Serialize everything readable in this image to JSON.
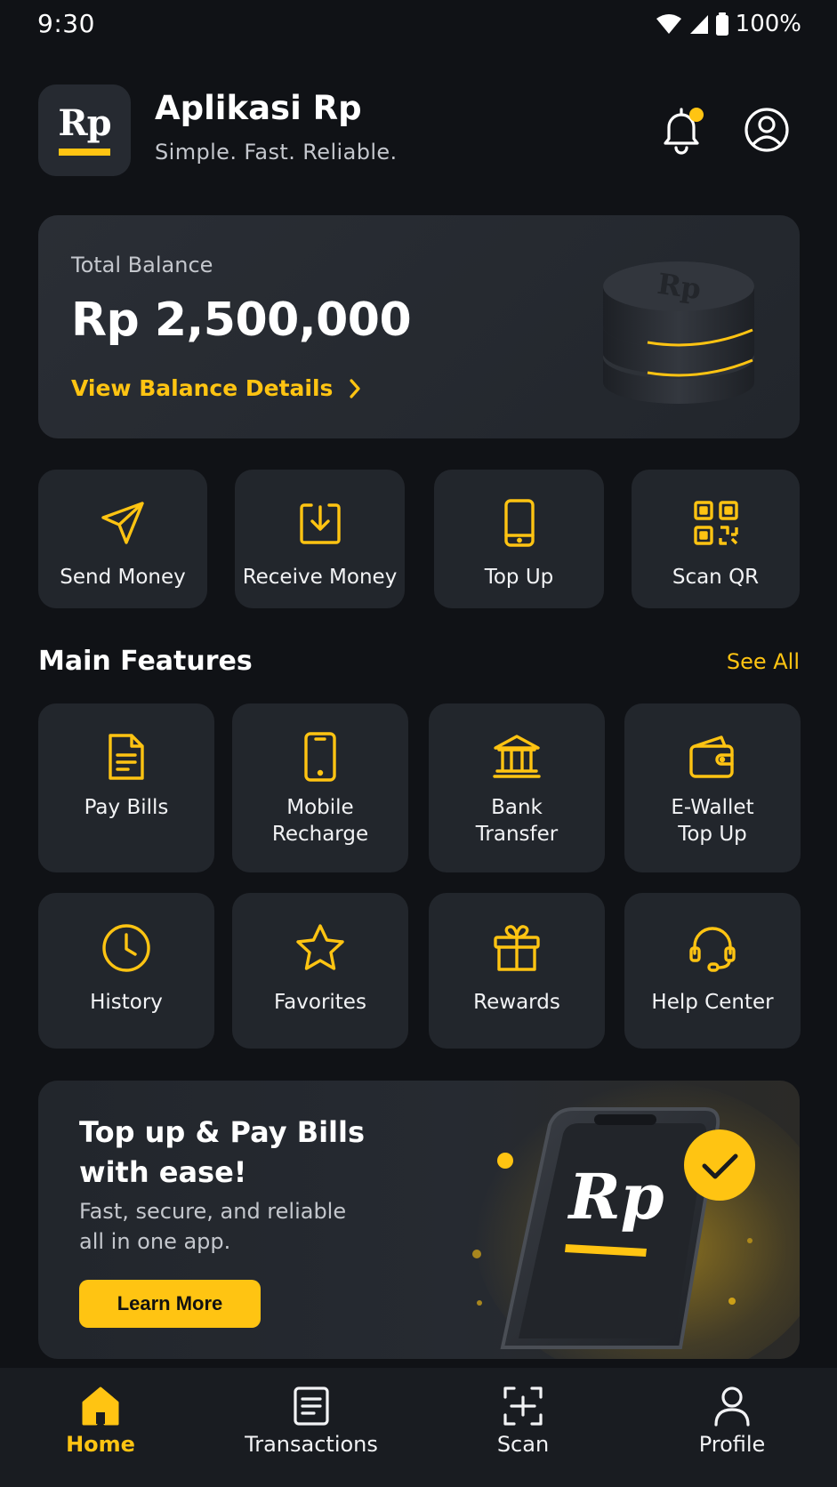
{
  "status_bar": {
    "time": "9:30",
    "battery": "100%"
  },
  "header": {
    "logo_text": "Rp",
    "title": "Aplikasi Rp",
    "subtitle": "Simple. Fast. Reliable."
  },
  "balance": {
    "label": "Total Balance",
    "amount": "Rp 2,500,000",
    "details_link": "View Balance Details",
    "coin_text": "Rp"
  },
  "quick_actions": [
    {
      "label": "Send Money",
      "icon": "send-icon"
    },
    {
      "label": "Receive Money",
      "icon": "receive-icon"
    },
    {
      "label": "Top Up",
      "icon": "phone-icon"
    },
    {
      "label": "Scan QR",
      "icon": "qr-code-icon"
    }
  ],
  "features": {
    "title": "Main Features",
    "see_all": "See All",
    "items": [
      {
        "label": "Pay Bills",
        "icon": "bill-icon"
      },
      {
        "label": "Mobile\nRecharge",
        "icon": "mobile-icon"
      },
      {
        "label": "Bank\nTransfer",
        "icon": "bank-icon"
      },
      {
        "label": "E-Wallet\nTop Up",
        "icon": "wallet-icon"
      },
      {
        "label": "History",
        "icon": "clock-icon"
      },
      {
        "label": "Favorites",
        "icon": "star-icon"
      },
      {
        "label": "Rewards",
        "icon": "gift-icon"
      },
      {
        "label": "Help Center",
        "icon": "headset-icon"
      }
    ]
  },
  "promo": {
    "title": "Top up & Pay Bills with ease!",
    "subtitle": "Fast, secure, and reliable all in one app.",
    "button": "Learn More",
    "phone_logo": "Rp"
  },
  "bottom_nav": [
    {
      "label": "Home",
      "icon": "home-icon",
      "active": true
    },
    {
      "label": "Transactions",
      "icon": "transactions-icon",
      "active": false
    },
    {
      "label": "Scan",
      "icon": "scan-icon",
      "active": false
    },
    {
      "label": "Profile",
      "icon": "profile-icon",
      "active": false
    }
  ],
  "colors": {
    "accent": "#FFC412",
    "background": "#101216",
    "card": "#22262c"
  }
}
